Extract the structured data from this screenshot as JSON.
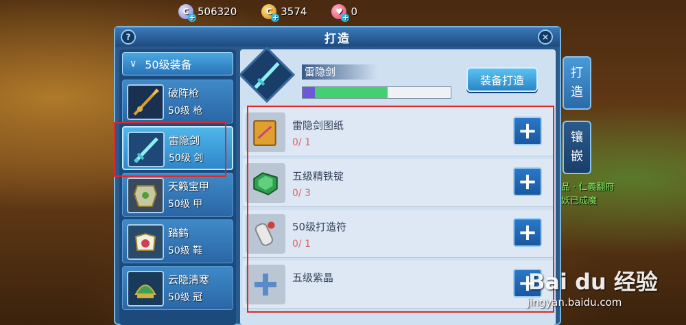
{
  "currency": {
    "silver": "506320",
    "gold": "3574",
    "heart": "0"
  },
  "panel": {
    "title": "打造",
    "help": "?",
    "close": "×"
  },
  "category": {
    "label": "50级装备"
  },
  "items": [
    {
      "name": "破阵枪",
      "level": "50级 枪",
      "icon": "spear-icon"
    },
    {
      "name": "雷隐剑",
      "level": "50级 剑",
      "icon": "sword-icon"
    },
    {
      "name": "天籁宝甲",
      "level": "50级 甲",
      "icon": "armor-icon"
    },
    {
      "name": "踏鹤",
      "level": "50级 鞋",
      "icon": "shoes-icon"
    },
    {
      "name": "云隐清寒",
      "level": "50级 冠",
      "icon": "helmet-icon"
    }
  ],
  "selected": {
    "name": "雷隐剑",
    "forge_button": "装备打造",
    "progress_colors": {
      "purple": "#6a5ad8",
      "green": "#44d070"
    }
  },
  "materials": [
    {
      "name": "雷隐剑图纸",
      "count": "0/ 1",
      "icon": "blueprint-icon"
    },
    {
      "name": "五级精铁锭",
      "count": "0/ 3",
      "icon": "iron-ingot-icon"
    },
    {
      "name": "50级打造符",
      "count": "0/ 1",
      "icon": "scroll-icon"
    },
    {
      "name": "五级紫晶",
      "count": "",
      "icon": "plus-placeholder-icon"
    }
  ],
  "side_tabs": [
    {
      "label_top": "打",
      "label_bottom": "造"
    },
    {
      "label_top": "镶",
      "label_bottom": "嵌"
    }
  ],
  "background_text": {
    "line1": "品 · 仁義翻府",
    "line2": "妖已成魔"
  },
  "watermark": {
    "brand": "Bai du 经验",
    "url": "jingyan.baidu.com"
  }
}
